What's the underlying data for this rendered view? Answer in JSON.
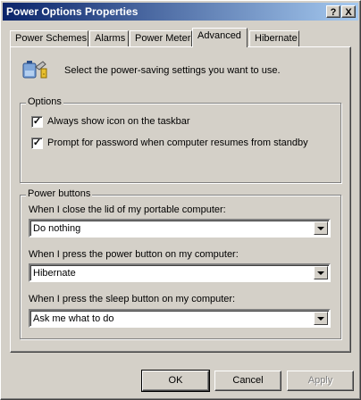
{
  "window": {
    "title": "Power Options Properties",
    "help_glyph": "?",
    "close_glyph": "X"
  },
  "tabs": [
    {
      "label": "Power Schemes"
    },
    {
      "label": "Alarms"
    },
    {
      "label": "Power Meter"
    },
    {
      "label": "Advanced"
    },
    {
      "label": "Hibernate"
    }
  ],
  "intro": {
    "text": "Select the power-saving settings you want to use."
  },
  "options": {
    "label": "Options",
    "show_icon": {
      "label": "Always show icon on the taskbar",
      "checked": true
    },
    "prompt_password": {
      "label": "Prompt for password when computer resumes from standby",
      "checked": true
    }
  },
  "power_buttons": {
    "label": "Power buttons",
    "lid": {
      "label": "When I close the lid of my portable computer:",
      "value": "Do nothing"
    },
    "power": {
      "label": "When I press the power button on my computer:",
      "value": "Hibernate"
    },
    "sleep": {
      "label": "When I press the sleep button on my computer:",
      "value": "Ask me what to do"
    }
  },
  "buttons": {
    "ok": "OK",
    "cancel": "Cancel",
    "apply": "Apply"
  },
  "colors": {
    "titlebar_start": "#0a246a",
    "titlebar_end": "#a6caf0",
    "face": "#d4d0c8"
  },
  "icons": {
    "power_options": "battery-plug-icon"
  }
}
